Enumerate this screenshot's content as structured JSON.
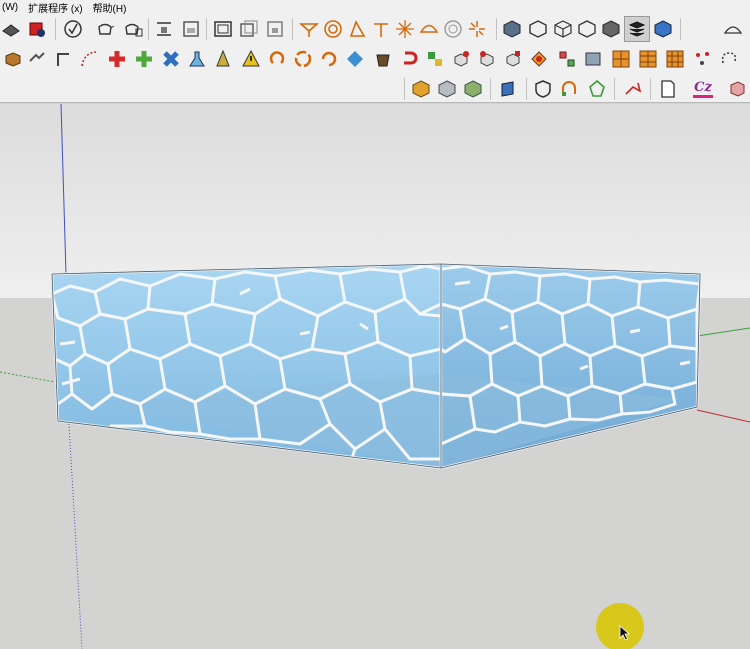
{
  "menubar": {
    "items": [
      "(W)",
      "扩展程序 (x)",
      "帮助(H)"
    ]
  },
  "colors": {
    "glass": "#9fd0ee",
    "mullion": "#f4f6f8",
    "sky": "#e9eaea",
    "ground": "#d3d3d1",
    "cursor_highlight": "#d8c70c"
  },
  "toolbar1": {
    "icons": [
      "section-plane-icon",
      "ruby-icon",
      "check-icon",
      "teapot-icon",
      "teapot-paint-icon",
      "align-bottom-icon",
      "frame-icon",
      "window-icon",
      "window-copy-icon",
      "lock-frame-icon",
      "shape-plane-icon",
      "circle-target-icon",
      "cone-icon",
      "pin-icon",
      "sun-icon",
      "bowl-icon",
      "sphere-icon",
      "burst-icon",
      "cube-view-icon",
      "shaded-cube-icon",
      "wire-cube-icon",
      "hex-icon",
      "solid-cube-icon",
      "layers-icon",
      "blue-cube-icon",
      "dome-icon"
    ]
  },
  "toolbar2": {
    "icons": [
      "box-icon",
      "arrows-icon",
      "corner-icon",
      "curve-dots-icon",
      "plus-red-icon",
      "plus-green-icon",
      "cross-blue-icon",
      "flask-icon",
      "tower-icon",
      "warning-icon",
      "undo-orange-icon",
      "spiral-icon",
      "refresh-icon",
      "diamond-icon",
      "bucket-icon",
      "hook-icon",
      "puzzle-icon",
      "gear-cube-icon",
      "rotate-cube-icon",
      "duplicate-cube-icon",
      "paint-cube-icon",
      "explode-icon",
      "grid-icon",
      "tiles-icon",
      "tiles-split-icon",
      "tiles-quad-icon",
      "scatter-icon",
      "lasso-icon"
    ]
  },
  "toolbar3": {
    "icons": [
      "gold-cube-icon",
      "silver-cube-icon",
      "green-cube-icon",
      "blue-panel-icon",
      "shield-icon",
      "magnet-icon",
      "net-icon",
      "pencil-line-icon",
      "page-icon",
      "cz-icon",
      "pink-box-icon"
    ],
    "cz_label": "Cz"
  }
}
